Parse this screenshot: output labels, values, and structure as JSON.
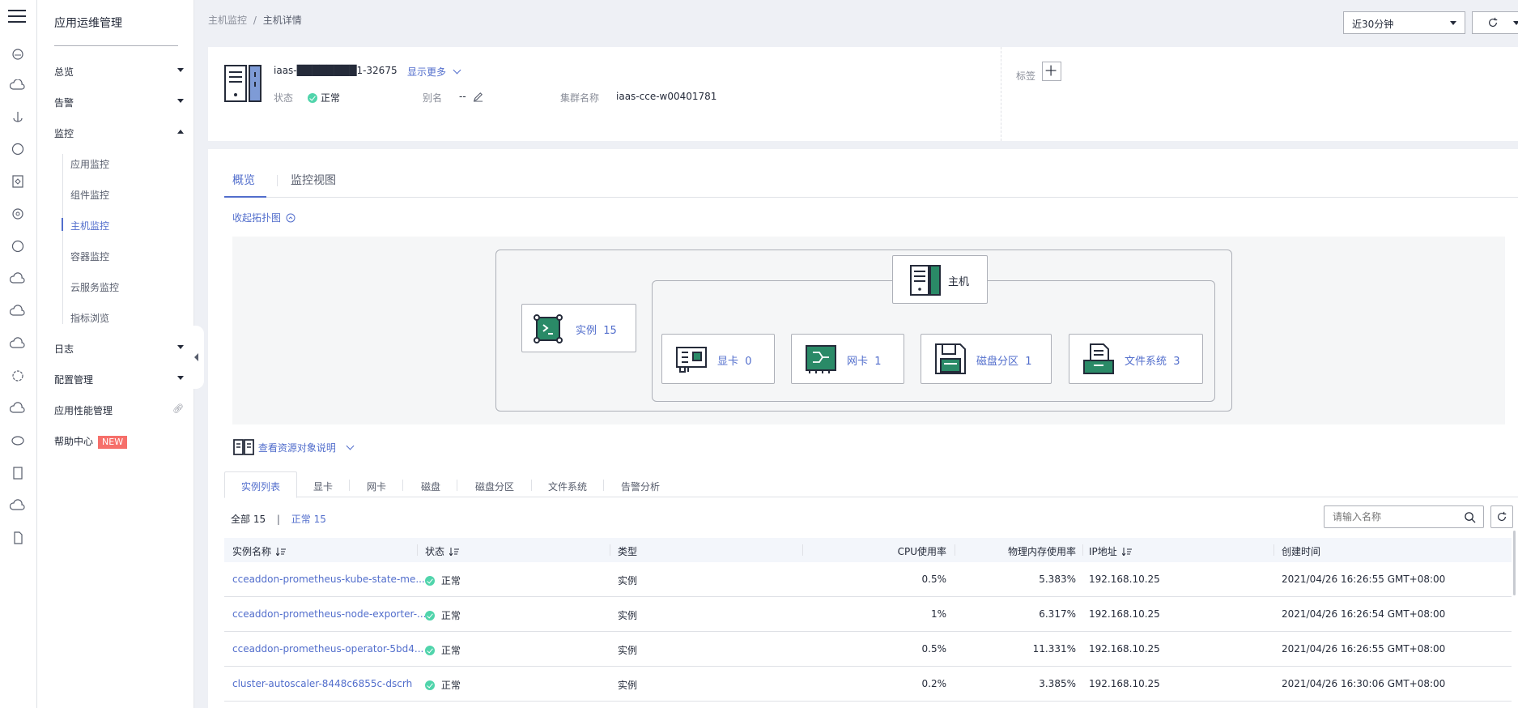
{
  "sidebar": {
    "title": "应用运维管理",
    "items": [
      {
        "label": "总览"
      },
      {
        "label": "告警"
      },
      {
        "label": "监控"
      },
      {
        "label": "日志"
      },
      {
        "label": "配置管理"
      },
      {
        "label": "应用性能管理"
      },
      {
        "label": "帮助中心",
        "badge": "NEW"
      }
    ],
    "monitor_sub": [
      "应用监控",
      "组件监控",
      "主机监控",
      "容器监控",
      "云服务监控",
      "指标浏览"
    ]
  },
  "breadcrumb": {
    "parent": "主机监控",
    "sep": "/",
    "current": "主机详情"
  },
  "toolbar": {
    "time_range": "近30分钟"
  },
  "host": {
    "name": "iaas-████████1-32675",
    "show_more": "显示更多",
    "status_label": "状态",
    "status_value": "正常",
    "alias_label": "别名",
    "alias_value": "--",
    "cluster_label": "集群名称",
    "cluster_value": "iaas-cce-w00401781",
    "tag_label": "标签"
  },
  "main_tabs": [
    {
      "label": "概览"
    },
    {
      "label": "监控视图"
    }
  ],
  "topology": {
    "collapse_label": "收起拓扑图",
    "host_label": "主机",
    "instance_label": "实例",
    "instance_count": "15",
    "gpu_label": "显卡",
    "gpu_count": "0",
    "nic_label": "网卡",
    "nic_count": "1",
    "disk_label": "磁盘分区",
    "disk_count": "1",
    "fs_label": "文件系统",
    "fs_count": "3"
  },
  "resource_help": "查看资源对象说明",
  "sub_tabs": [
    {
      "label": "实例列表"
    },
    {
      "label": "显卡"
    },
    {
      "label": "网卡"
    },
    {
      "label": "磁盘"
    },
    {
      "label": "磁盘分区"
    },
    {
      "label": "文件系统"
    },
    {
      "label": "告警分析"
    }
  ],
  "summary": {
    "all_label": "全部 15",
    "sep": "|",
    "normal_label": "正常 15"
  },
  "search": {
    "placeholder": "请输入名称"
  },
  "table": {
    "columns": [
      "实例名称",
      "状态",
      "类型",
      "CPU使用率",
      "物理内存使用率",
      "IP地址",
      "创建时间"
    ],
    "rows": [
      {
        "name": "cceaddon-prometheus-kube-state-me...",
        "status": "正常",
        "type": "实例",
        "cpu": "0.5%",
        "mem": "5.383%",
        "ip": "192.168.10.25",
        "created": "2021/04/26 16:26:55 GMT+08:00"
      },
      {
        "name": "cceaddon-prometheus-node-exporter-...",
        "status": "正常",
        "type": "实例",
        "cpu": "1%",
        "mem": "6.317%",
        "ip": "192.168.10.25",
        "created": "2021/04/26 16:26:54 GMT+08:00"
      },
      {
        "name": "cceaddon-prometheus-operator-5bd4...",
        "status": "正常",
        "type": "实例",
        "cpu": "0.5%",
        "mem": "11.331%",
        "ip": "192.168.10.25",
        "created": "2021/04/26 16:26:55 GMT+08:00"
      },
      {
        "name": "cluster-autoscaler-8448c6855c-dscrh",
        "status": "正常",
        "type": "实例",
        "cpu": "0.2%",
        "mem": "3.385%",
        "ip": "192.168.10.25",
        "created": "2021/04/26 16:30:06 GMT+08:00"
      }
    ]
  },
  "colors": {
    "accent": "#526ecc",
    "ok": "#50d4ab",
    "badge": "#f66f6a",
    "icon_green": "#2a8a67"
  }
}
